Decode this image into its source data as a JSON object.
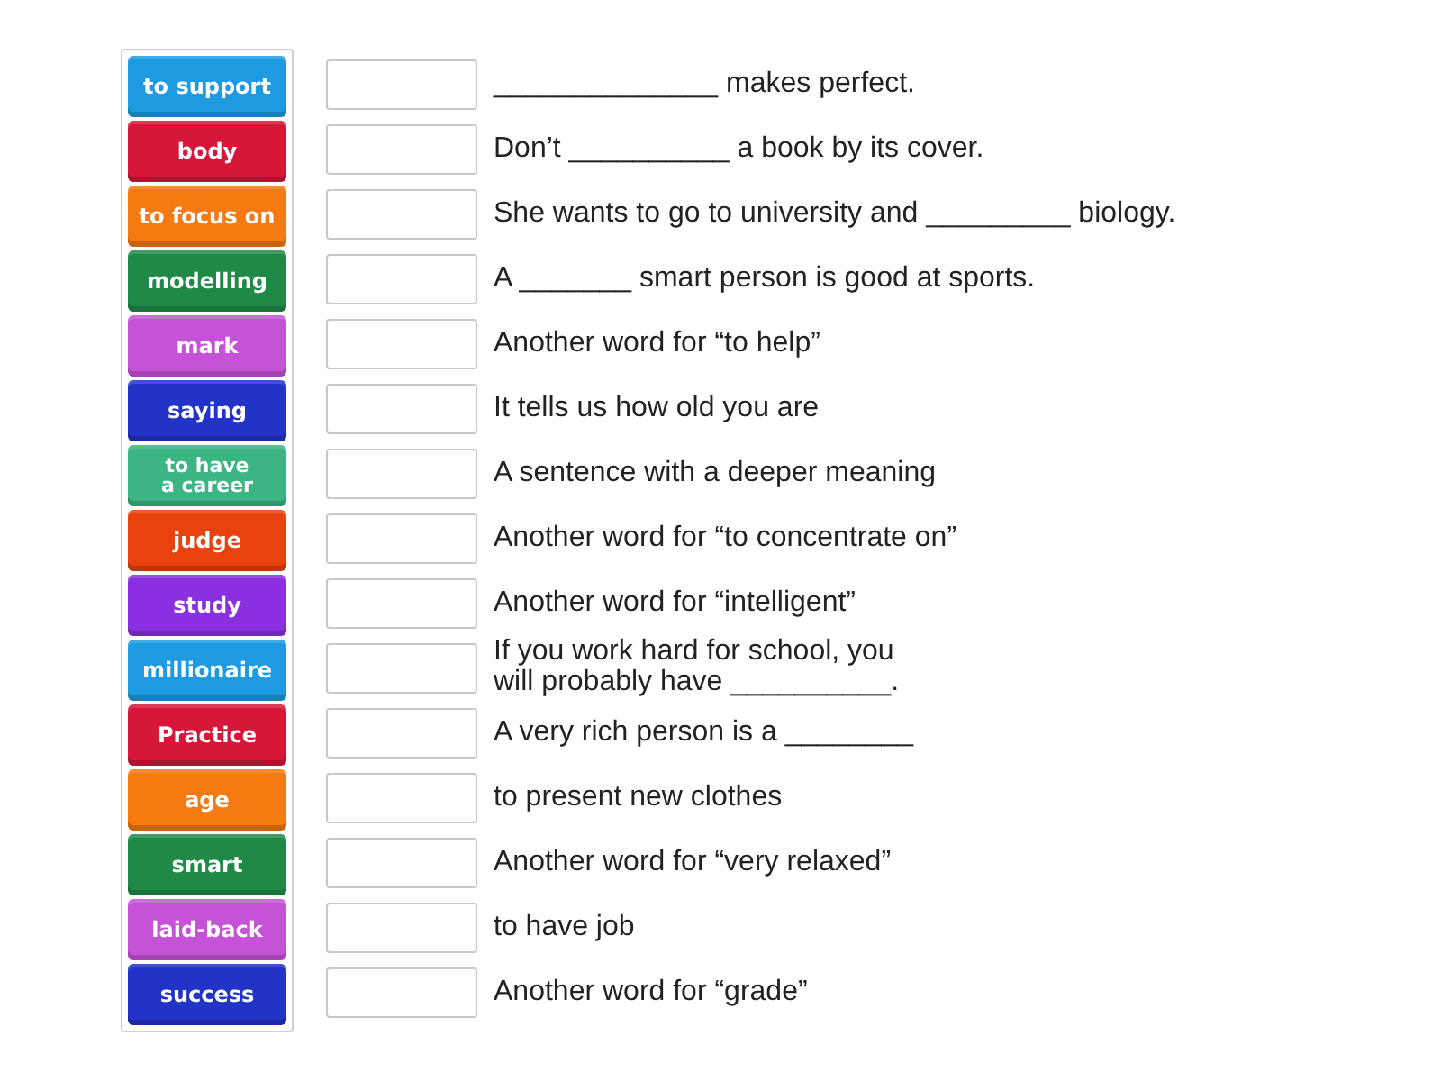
{
  "tiles": [
    {
      "label": "to support",
      "color": "#1e9be0"
    },
    {
      "label": "body",
      "color": "#d6173a"
    },
    {
      "label": "to focus on",
      "color": "#f57a12"
    },
    {
      "label": "modelling",
      "color": "#1f8a48"
    },
    {
      "label": "mark",
      "color": "#c652d8"
    },
    {
      "label": "saying",
      "color": "#2234c8"
    },
    {
      "label": "to have\na career",
      "color": "#3bb582"
    },
    {
      "label": "judge",
      "color": "#e8420e"
    },
    {
      "label": "study",
      "color": "#8a30e0"
    },
    {
      "label": "millionaire",
      "color": "#1e9be0"
    },
    {
      "label": "Practice",
      "color": "#d6173a"
    },
    {
      "label": "age",
      "color": "#f57a12"
    },
    {
      "label": "smart",
      "color": "#1f8a48"
    },
    {
      "label": "laid-back",
      "color": "#c652d8"
    },
    {
      "label": "success",
      "color": "#2234c8"
    }
  ],
  "rows": [
    {
      "text": "______________ makes perfect."
    },
    {
      "text": "Don’t __________ a book by its cover."
    },
    {
      "text": "She wants to go to university and _________ biology."
    },
    {
      "text": "A _______ smart person is good at sports."
    },
    {
      "text": "Another word for “to help”"
    },
    {
      "text": "It tells us how old you are"
    },
    {
      "text": "A sentence with a deeper meaning"
    },
    {
      "text": "Another word for “to concentrate on”"
    },
    {
      "text": "Another word for “intelligent”"
    },
    {
      "text": "If you work hard for school, you\nwill probably have __________."
    },
    {
      "text": "A very rich person is a ________"
    },
    {
      "text": "to present new clothes"
    },
    {
      "text": "Another word for “very relaxed”"
    },
    {
      "text": "to have job"
    },
    {
      "text": "Another word for “grade”"
    }
  ]
}
